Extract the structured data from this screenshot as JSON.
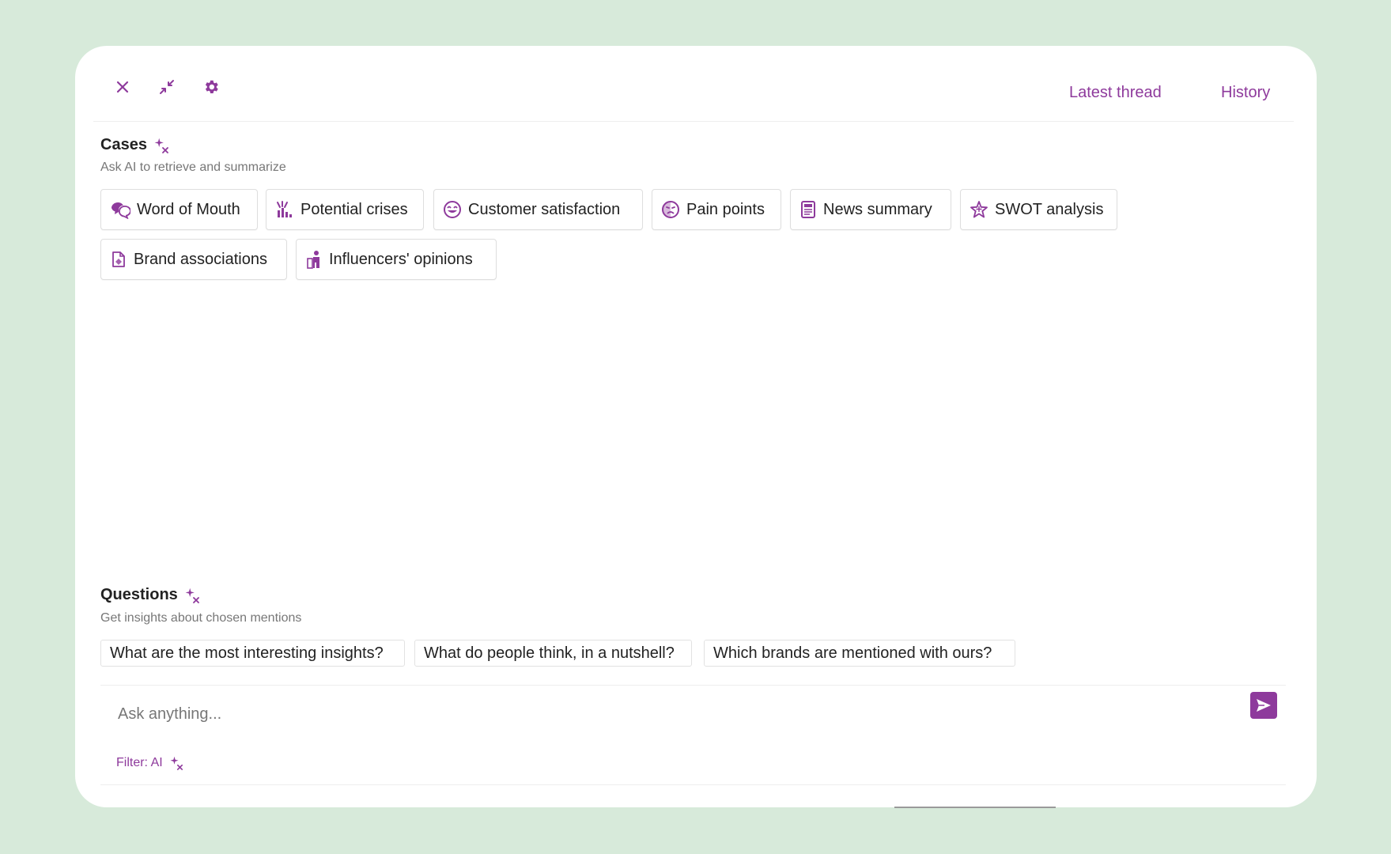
{
  "colors": {
    "accent": "#8e3a9c",
    "background": "#d7eada",
    "panel": "#ffffff"
  },
  "topbar": {
    "icons": [
      "close-icon",
      "minimize-icon",
      "gear-icon"
    ],
    "latest_thread": "Latest thread",
    "history": "History"
  },
  "cases": {
    "title": "Cases",
    "subtitle": "Ask AI to retrieve and summarize",
    "items": [
      {
        "label": "Word of Mouth",
        "icon": "speech-bubbles-icon"
      },
      {
        "label": "Potential crises",
        "icon": "crisis-chart-icon"
      },
      {
        "label": "Customer satisfaction",
        "icon": "smile-face-icon"
      },
      {
        "label": "Pain points",
        "icon": "sad-face-icon"
      },
      {
        "label": "News summary",
        "icon": "newspaper-icon"
      },
      {
        "label": "SWOT analysis",
        "icon": "star-swot-icon"
      },
      {
        "label": "Brand associations",
        "icon": "tag-document-icon"
      },
      {
        "label": "Influencers' opinions",
        "icon": "influencer-person-icon"
      }
    ]
  },
  "questions": {
    "title": "Questions",
    "subtitle": "Get insights about chosen mentions",
    "items": [
      "What are the most interesting insights?",
      "What do people think, in a nutshell?",
      "Which brands are mentioned with ours?"
    ]
  },
  "composer": {
    "placeholder": "Ask anything...",
    "filter_label": "Filter: AI"
  }
}
